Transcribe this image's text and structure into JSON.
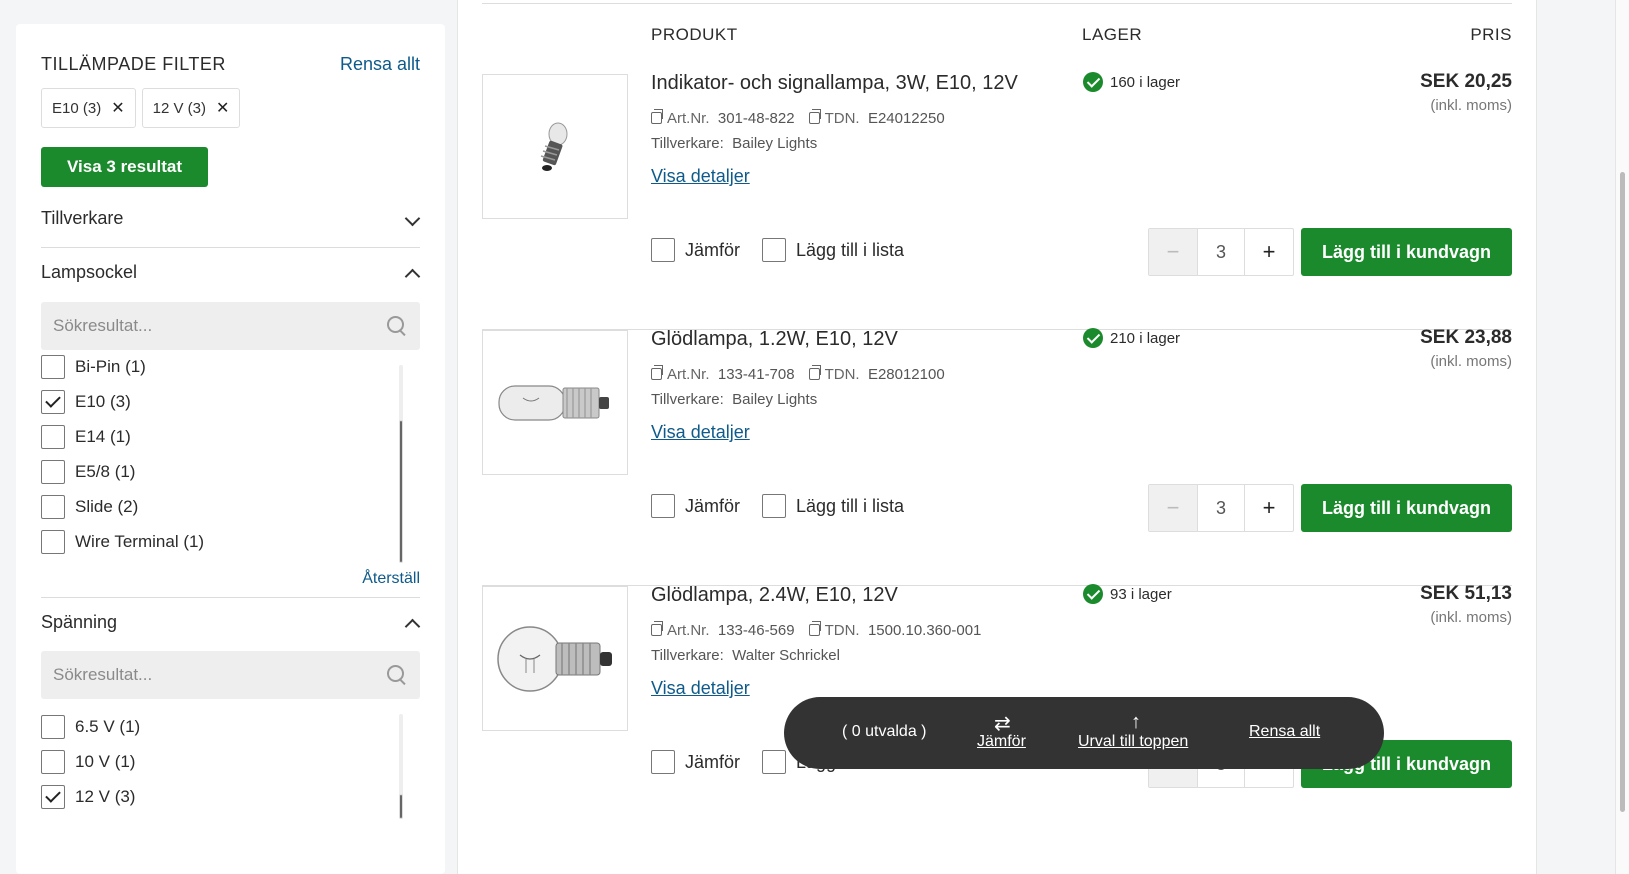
{
  "sidebar": {
    "title": "TILLÄMPADE FILTER",
    "clear_all": "Rensa allt",
    "chips": [
      {
        "label": "E10 (3)"
      },
      {
        "label": "12 V (3)"
      }
    ],
    "show_results": "Visa 3 resultat",
    "manufacturer": {
      "label": "Tillverkare"
    },
    "lampsocket": {
      "label": "Lampsockel",
      "search_placeholder": "Sökresultat...",
      "options": [
        {
          "label": "Bi-Pin (1)",
          "checked": false
        },
        {
          "label": "E10 (3)",
          "checked": true
        },
        {
          "label": "E14 (1)",
          "checked": false
        },
        {
          "label": "E5/8 (1)",
          "checked": false
        },
        {
          "label": "Slide (2)",
          "checked": false
        },
        {
          "label": "Wire Terminal (1)",
          "checked": false
        }
      ],
      "reset": "Återställ"
    },
    "voltage": {
      "label": "Spänning",
      "search_placeholder": "Sökresultat...",
      "options": [
        {
          "label": "6.5 V (1)",
          "checked": false
        },
        {
          "label": "10 V (1)",
          "checked": false
        },
        {
          "label": "12 V (3)",
          "checked": true
        }
      ]
    }
  },
  "table": {
    "col_product": "PRODUKT",
    "col_stock": "LAGER",
    "col_price": "PRIS"
  },
  "products": [
    {
      "name": "Indikator- och signallampa, 3W, E10, 12V",
      "art_label": "Art.Nr.",
      "art": "301-48-822",
      "tdn_label": "TDN.",
      "tdn": "E24012250",
      "mfr_label": "Tillverkare:",
      "mfr": "Bailey Lights",
      "details": "Visa detaljer",
      "stock": "160 i lager",
      "price": "SEK 20,25",
      "vat": "(inkl. moms)",
      "compare": "Jämför",
      "add_list": "Lägg till i lista",
      "qty": "3",
      "cart": "Lägg till i kundvagn"
    },
    {
      "name": "Glödlampa, 1.2W, E10, 12V",
      "art_label": "Art.Nr.",
      "art": "133-41-708",
      "tdn_label": "TDN.",
      "tdn": "E28012100",
      "mfr_label": "Tillverkare:",
      "mfr": "Bailey Lights",
      "details": "Visa detaljer",
      "stock": "210 i lager",
      "price": "SEK 23,88",
      "vat": "(inkl. moms)",
      "compare": "Jämför",
      "add_list": "Lägg till i lista",
      "qty": "3",
      "cart": "Lägg till i kundvagn"
    },
    {
      "name": "Glödlampa, 2.4W, E10, 12V",
      "art_label": "Art.Nr.",
      "art": "133-46-569",
      "tdn_label": "TDN.",
      "tdn": "1500.10.360-001",
      "mfr_label": "Tillverkare:",
      "mfr": "Walter Schrickel",
      "details": "Visa detaljer",
      "stock": "93 i lager",
      "price": "SEK 51,13",
      "vat": "(inkl. moms)",
      "compare": "Jämför",
      "add_list": "Lägg",
      "qty": "3",
      "cart": "Lägg till i kundvagn"
    }
  ],
  "compare_bar": {
    "selected": "( 0 utvalda )",
    "compare": "Jämför",
    "to_top": "Urval till toppen",
    "clear": "Rensa allt"
  },
  "colors": {
    "accent_green": "#1b8a2d",
    "link_blue": "#0e5a8a",
    "bar_dark": "#333333"
  }
}
